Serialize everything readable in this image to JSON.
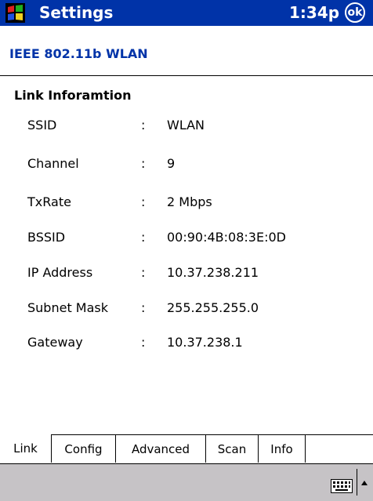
{
  "titlebar": {
    "title": "Settings",
    "clock": "1:34p",
    "ok_label": "ok"
  },
  "app": {
    "title": "IEEE 802.11b WLAN"
  },
  "link_info": {
    "section_title": "Link Inforamtion",
    "separator": ":",
    "rows": [
      {
        "label": "SSID",
        "value": "WLAN"
      },
      {
        "label": "Channel",
        "value": "9"
      },
      {
        "label": "TxRate",
        "value": "2 Mbps"
      },
      {
        "label": "BSSID",
        "value": "00:90:4B:08:3E:0D"
      },
      {
        "label": "IP Address",
        "value": "10.37.238.211"
      },
      {
        "label": "Subnet Mask",
        "value": "255.255.255.0"
      },
      {
        "label": "Gateway",
        "value": "10.37.238.1"
      }
    ]
  },
  "tabs": [
    {
      "label": "Link",
      "active": true
    },
    {
      "label": "Config",
      "active": false
    },
    {
      "label": "Advanced",
      "active": false
    },
    {
      "label": "Scan",
      "active": false
    },
    {
      "label": "Info",
      "active": false
    }
  ],
  "colors": {
    "titlebar_bg": "#0033a8",
    "accent": "#0033a8",
    "menubar_bg": "#c6c3c6"
  },
  "icons": {
    "start": "windows-flag-icon",
    "keyboard": "keyboard-icon",
    "sip_arrow": "arrow-up-icon"
  }
}
